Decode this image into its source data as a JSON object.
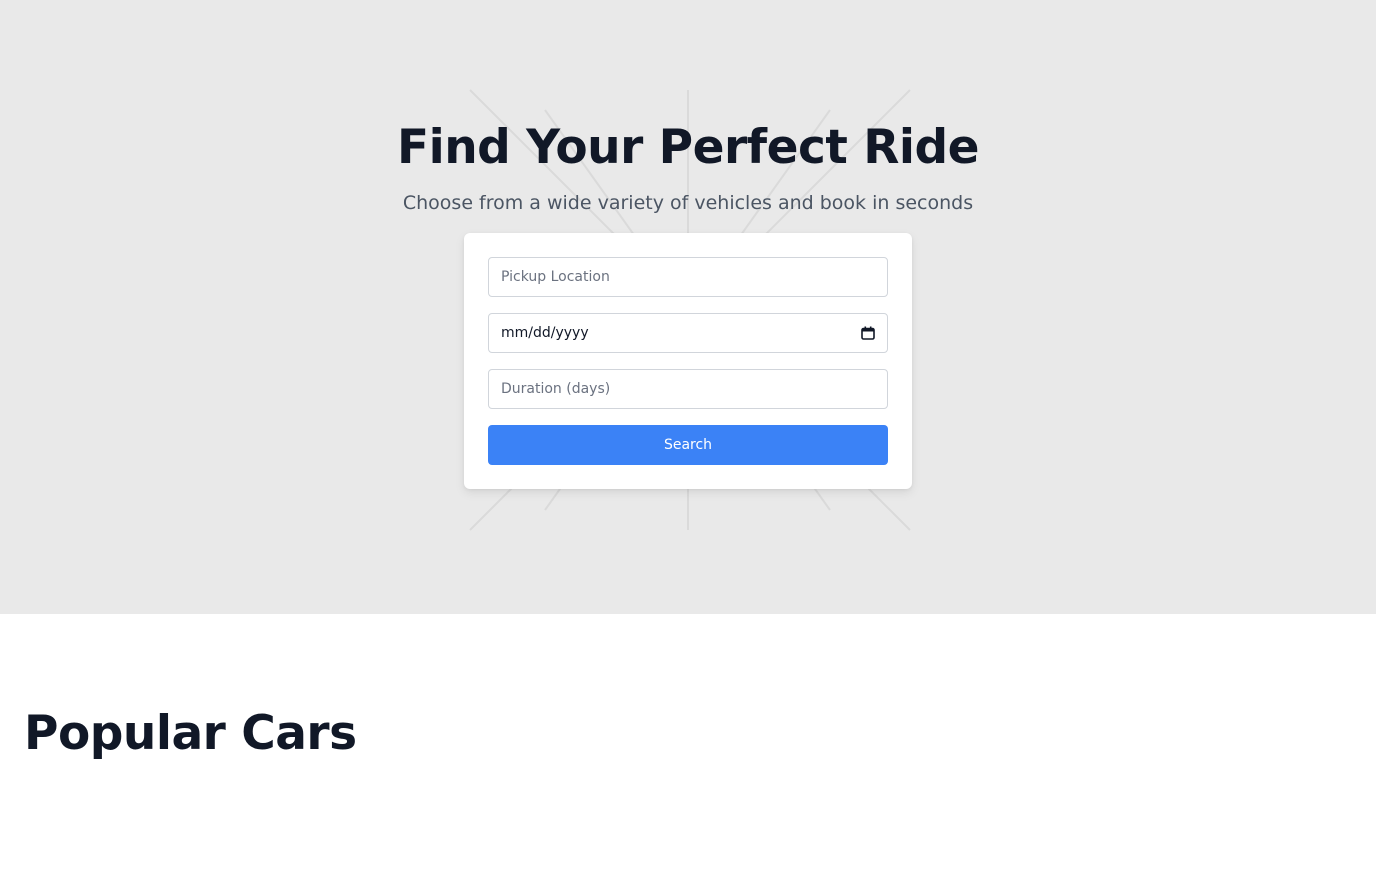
{
  "hero": {
    "title": "Find Your Perfect Ride",
    "subtitle": "Choose from a wide variety of vehicles and book in seconds",
    "background_color": "#e9e9e9"
  },
  "search_form": {
    "pickup_placeholder": "Pickup Location",
    "pickup_value": "",
    "date_display": "mm/dd/yyyy",
    "duration_placeholder": "Duration (days)",
    "duration_value": "",
    "search_label": "Search",
    "search_color": "#3b82f6",
    "calendar_icon": "calendar-icon"
  },
  "popular": {
    "title": "Popular Cars"
  }
}
